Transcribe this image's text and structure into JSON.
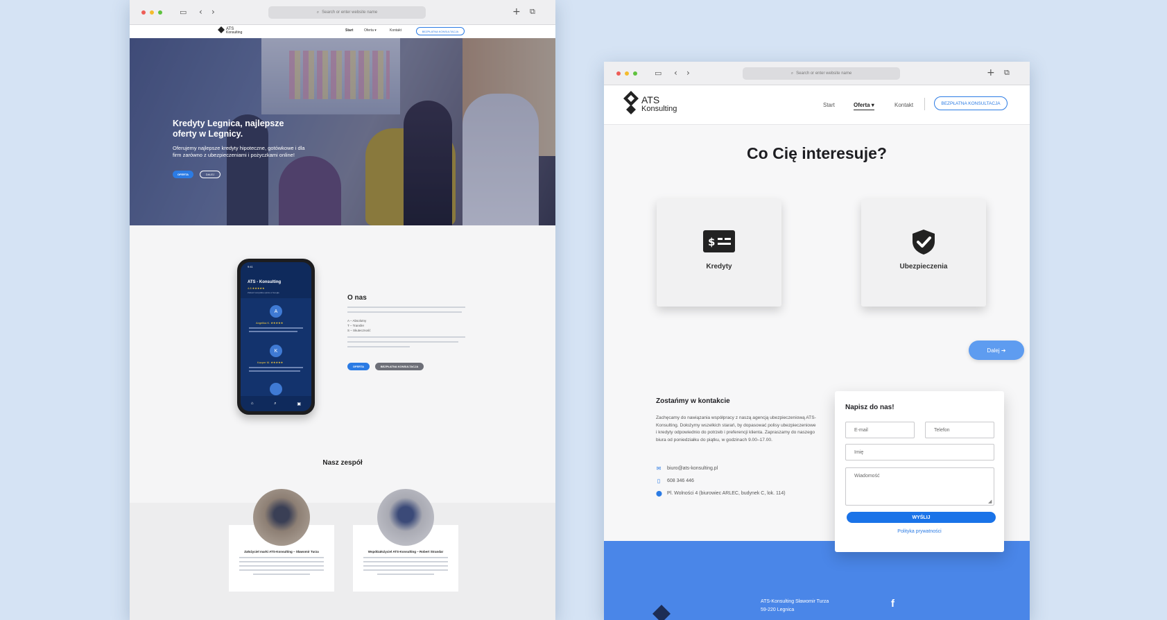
{
  "left_window": {
    "url_placeholder": "Search or enter website name",
    "logo_text": "ATS",
    "logo_sub": "Konsulting",
    "nav": [
      "Start",
      "Oferta ▾",
      "Kontakt"
    ],
    "cta": "BEZPŁATNA KONSULTACJA",
    "hero": {
      "title": "Kredyty Legnica, najlepsze oferty w Legnicy.",
      "subtitle": "Oferujemy najlepsze kredyty hipoteczne, gotówkowe i dla firm zarówno z ubezpieczeniami i pożyczkami online!",
      "btn_primary": "OFERTA",
      "btn_secondary": "DALEJ"
    },
    "phone": {
      "time": "9:41",
      "title": "ATS - Konsulting",
      "rating": "4.8 ★★★★★",
      "sub": "Zobacz wszystkie opinie w Google",
      "reviews": [
        {
          "initial": "A",
          "name": "Angelika K. ★★★★★"
        },
        {
          "initial": "K",
          "name": "Kacper M. ★★★★★"
        }
      ]
    },
    "about": {
      "title": "O nas",
      "lines": [
        "A – Absolutny",
        "T – Transfer",
        "S – Skuteczność"
      ],
      "btn_primary": "OFERTA",
      "btn_secondary": "BEZPŁATNA KONSULTACJA"
    },
    "team": {
      "title": "Nasz zespół",
      "members": [
        {
          "role": "Założyciel marki ATS-Konsulting – Sławomir Turza"
        },
        {
          "role": "Współzałożyciel ATS-Konsulting – Robert Strandar"
        }
      ]
    }
  },
  "right_window": {
    "url_placeholder": "Search or enter website name",
    "logo_text": "ATS",
    "logo_sub": "Konsulting",
    "nav": {
      "start": "Start",
      "oferta": "Oferta ▾",
      "kontakt": "Kontakt"
    },
    "cta": "BEZPŁATNA KONSULTACJA",
    "heading": "Co Cię interesuje?",
    "cards": [
      {
        "label": "Kredyty",
        "icon": "money-icon"
      },
      {
        "label": "Ubezpieczenia",
        "icon": "shield-check-icon"
      }
    ],
    "next_btn": "Dalej ➔",
    "contact": {
      "title": "Zostańmy w kontakcie",
      "body": "Zachęcamy do nawiązania współpracy z naszą agencją ubezpieczeniową ATS-Konsulting. Dołożymy wszelkich starań, by dopasować polisy ubezpieczeniowe i kredyty odpowiednio do potrzeb i preferencji klienta. Zapraszamy do naszego biura od poniedziałku do piątku, w godzinach 9.00–17.00.",
      "email": "biuro@ats-konsulting.pl",
      "phone": "608 346 446",
      "address": "Pl. Wolności 4 (biurowiec ARLEC, budynek C, lok. 114)"
    },
    "form": {
      "title": "Napisz do nas!",
      "email": "E-mail",
      "phone": "Telefon",
      "name": "Imię",
      "message": "Wiadomość",
      "submit": "WYŚLIJ",
      "privacy": "Polityka prywatności"
    },
    "footer": {
      "company": "ATS-Konsulting Sławomir Turza",
      "city": "59-220 Legnica"
    }
  },
  "colors": {
    "accent": "#2b7be4",
    "footer": "#4a86e8",
    "navy": "#0f2a5c",
    "bg": "#d5e3f4"
  }
}
